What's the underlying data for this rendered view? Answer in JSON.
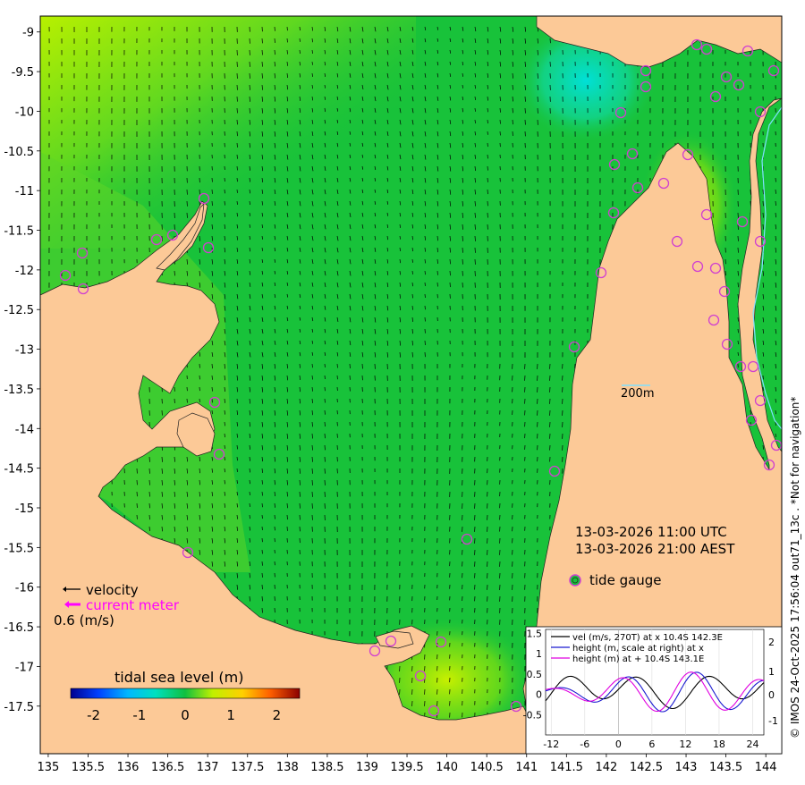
{
  "axes": {
    "x_ticks": [
      "135",
      "135.5",
      "136",
      "136.5",
      "137",
      "137.5",
      "138",
      "138.5",
      "139",
      "139.5",
      "140",
      "140.5",
      "141",
      "141.5",
      "142",
      "142.5",
      "143",
      "143.5",
      "144"
    ],
    "y_ticks": [
      "-9",
      "-9.5",
      "-10",
      "-10.5",
      "-11",
      "-11.5",
      "-12",
      "-12.5",
      "-13",
      "-13.5",
      "-14",
      "-14.5",
      "-15",
      "-15.5",
      "-16",
      "-16.5",
      "-17",
      "-17.5"
    ],
    "x_range": [
      134.9,
      144.2
    ],
    "y_range": [
      -8.8,
      -18.1
    ]
  },
  "timestamps": {
    "utc": "13-03-2026 11:00 UTC",
    "local": "13-03-2026 21:00 AEST"
  },
  "legend": {
    "tide_gauge": "tide gauge",
    "velocity": "velocity",
    "current_meter": "current meter",
    "velocity_scale": "0.6 (m/s)",
    "depth_contour": "200m"
  },
  "colorbar": {
    "title": "tidal sea level (m)",
    "ticks": [
      "-2",
      "-1",
      "0",
      "1",
      "2"
    ],
    "range": [
      -2.5,
      2.5
    ]
  },
  "copyright": "© IMOS 24-Oct-2025 17:56:04 out71_13c . *Not for navigation*",
  "inset": {
    "legend": [
      {
        "label": "vel (m/s, 270T) at x 10.4S 142.3E",
        "color": "#000000"
      },
      {
        "label": "height (m, scale at right) at x",
        "color": "#1a1ad0"
      },
      {
        "label": "height (m) at + 10.4S 143.1E",
        "color": "#e000e0"
      }
    ],
    "x_ticks": [
      "-12",
      "-6",
      "0",
      "6",
      "12",
      "18",
      "24"
    ],
    "y_left_ticks": [
      "1.5",
      "1",
      "0.5",
      "0",
      "-0.5"
    ],
    "y_right_ticks": [
      "2",
      "1",
      "0",
      "-1"
    ],
    "x_range": [
      -13,
      26
    ],
    "y_left_range": [
      -1.0,
      1.6
    ]
  },
  "colors": {
    "land": "#fcc997",
    "sea": "#18c23a",
    "velocity": "#000000",
    "current_meter": "#ff00ff",
    "tide_gauge_ring": "#d040d0"
  }
}
